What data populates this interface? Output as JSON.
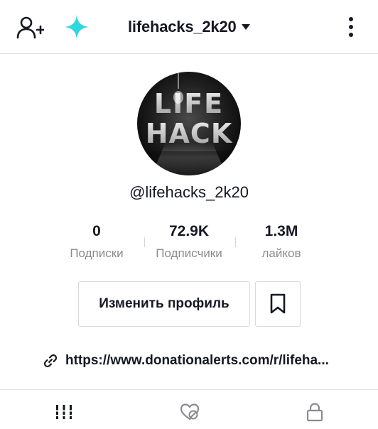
{
  "header": {
    "username": "lifehacks_2k20",
    "left_icons": [
      "add-user-icon",
      "sparkle-icon"
    ],
    "right_icon": "kebab-menu-icon",
    "sparkle_color": "#2fd7e0"
  },
  "profile": {
    "avatar_text_line1": "LIFE",
    "avatar_text_line2": "HACK",
    "handle": "@lifehacks_2k20"
  },
  "stats": [
    {
      "value": "0",
      "label": "Подписки"
    },
    {
      "value": "72.9K",
      "label": "Подписчики"
    },
    {
      "value": "1.3M",
      "label": "лайков"
    }
  ],
  "actions": {
    "edit_profile_label": "Изменить профиль",
    "bookmark_icon": "bookmark-icon"
  },
  "bio": {
    "link_icon": "link-icon",
    "link_text": "https://www.donationalerts.com/r/lifeha..."
  },
  "tabs": [
    {
      "icon": "grid-icon",
      "active": true
    },
    {
      "icon": "liked-hidden-icon",
      "active": false
    },
    {
      "icon": "lock-icon",
      "active": false
    }
  ]
}
